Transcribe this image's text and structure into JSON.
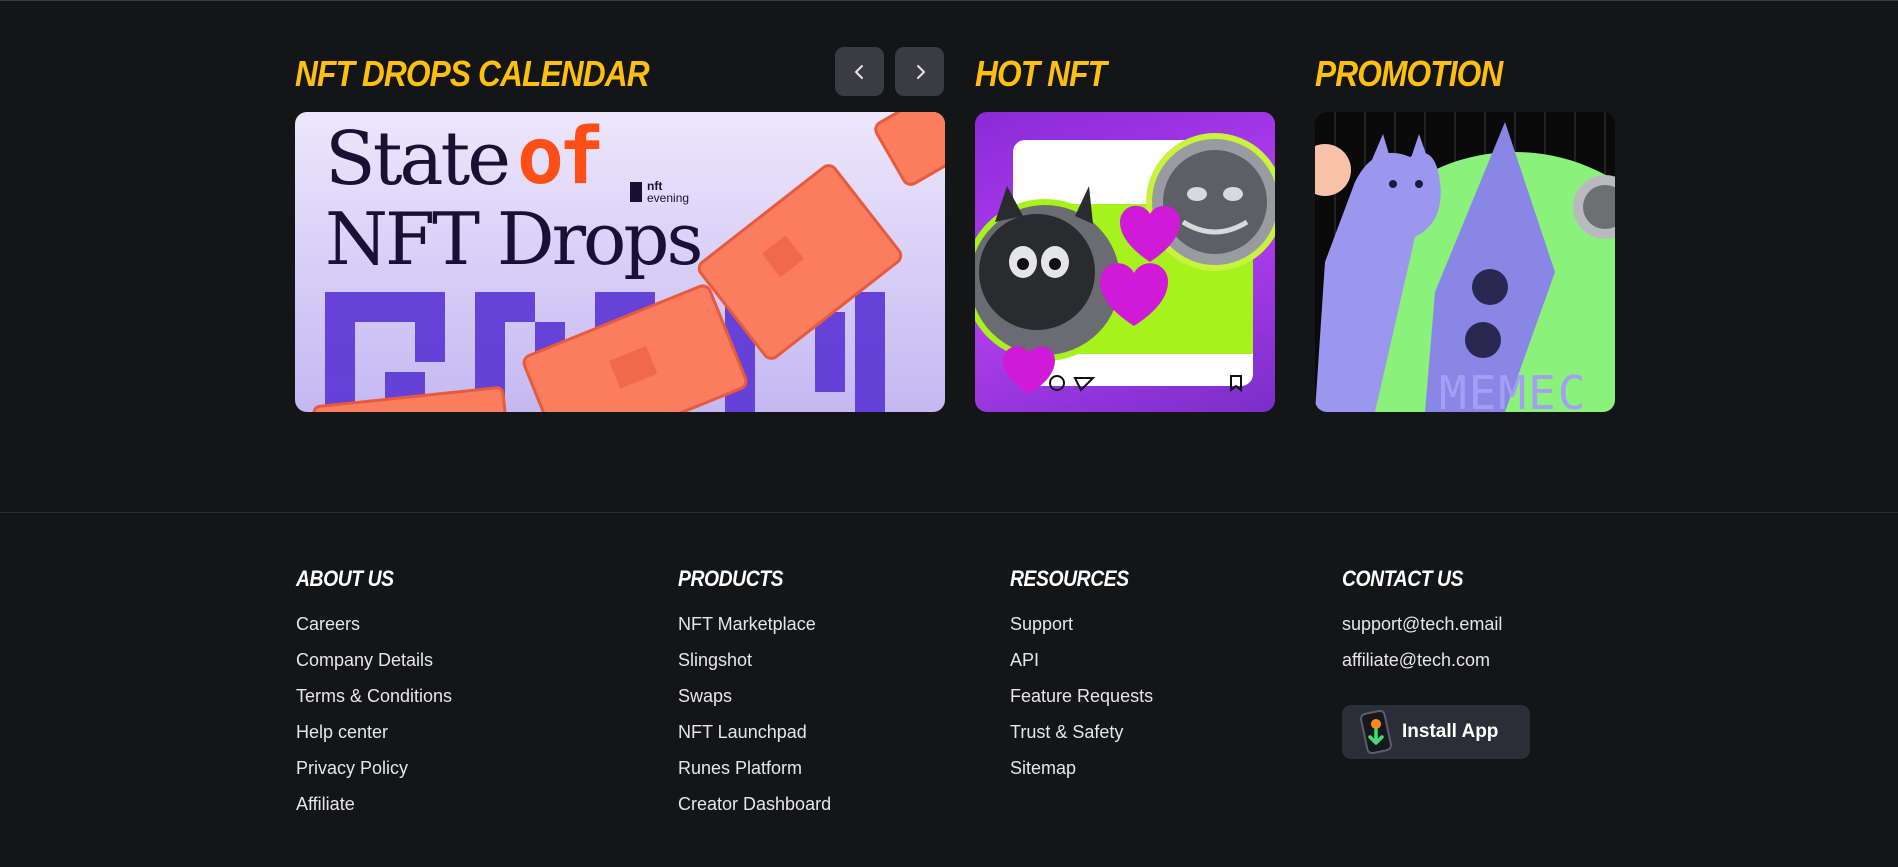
{
  "sections": {
    "drops_title": "NFT DROPS CALENDAR",
    "hot_title": "HOT NFT",
    "promo_title": "PROMOTION"
  },
  "banner": {
    "headline_line1": "State",
    "headline_of": "of",
    "headline_line2": "NFT Drops",
    "logo_text_1": "nft",
    "logo_text_2": "evening"
  },
  "promo_card": {
    "overlay_text": "MEMEC"
  },
  "footer": {
    "about": {
      "heading": "ABOUT US",
      "links": [
        "Careers",
        "Company Details",
        "Terms & Conditions",
        "Help center",
        "Privacy Policy",
        "Affiliate"
      ]
    },
    "products": {
      "heading": "PRODUCTS",
      "links": [
        "NFT Marketplace",
        "Slingshot",
        "Swaps",
        "NFT Launchpad",
        "Runes Platform",
        "Creator Dashboard"
      ]
    },
    "resources": {
      "heading": "RESOURCES",
      "links": [
        "Support",
        "API",
        "Feature Requests",
        "Trust & Safety",
        "Sitemap"
      ]
    },
    "contact": {
      "heading": "CONTACT US",
      "links": [
        "support@tech.email",
        "affiliate@tech.com"
      ],
      "install_label": "Install App"
    }
  },
  "colors": {
    "background": "#141517",
    "accent_yellow": "#ffbf0f",
    "promo_green": "#8af27a",
    "banner_orange": "#fb7d5f",
    "banner_purple": "#5b34d6"
  },
  "icons": {
    "prev": "chevron-left-icon",
    "next": "chevron-right-icon",
    "install": "phone-download-icon"
  }
}
